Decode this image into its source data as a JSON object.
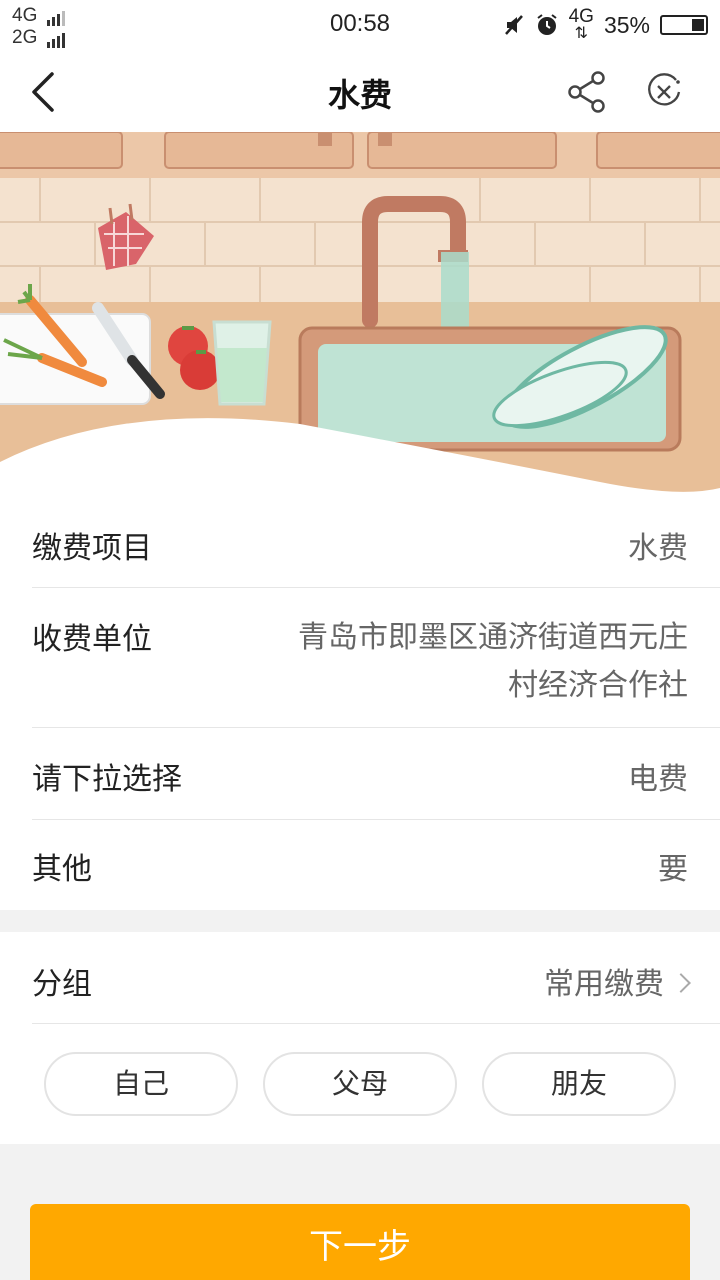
{
  "status": {
    "net1": "4G",
    "net2": "2G",
    "time": "00:58",
    "net3": "4G",
    "battery": "35%"
  },
  "nav": {
    "title": "水费"
  },
  "form": {
    "rows": [
      {
        "label": "缴费项目",
        "value": "水费"
      },
      {
        "label": "收费单位",
        "value_line1": "青岛市即墨区通济街道西元庄",
        "value_line2": "村经济合作社"
      },
      {
        "label": "请下拉选择",
        "value": "电费"
      },
      {
        "label": "其他",
        "value": "要"
      }
    ]
  },
  "group": {
    "label": "分组",
    "value": "常用缴费",
    "chips": [
      "自己",
      "父母",
      "朋友"
    ]
  },
  "next_button": "下一步",
  "colors": {
    "accent": "#ffa800"
  }
}
